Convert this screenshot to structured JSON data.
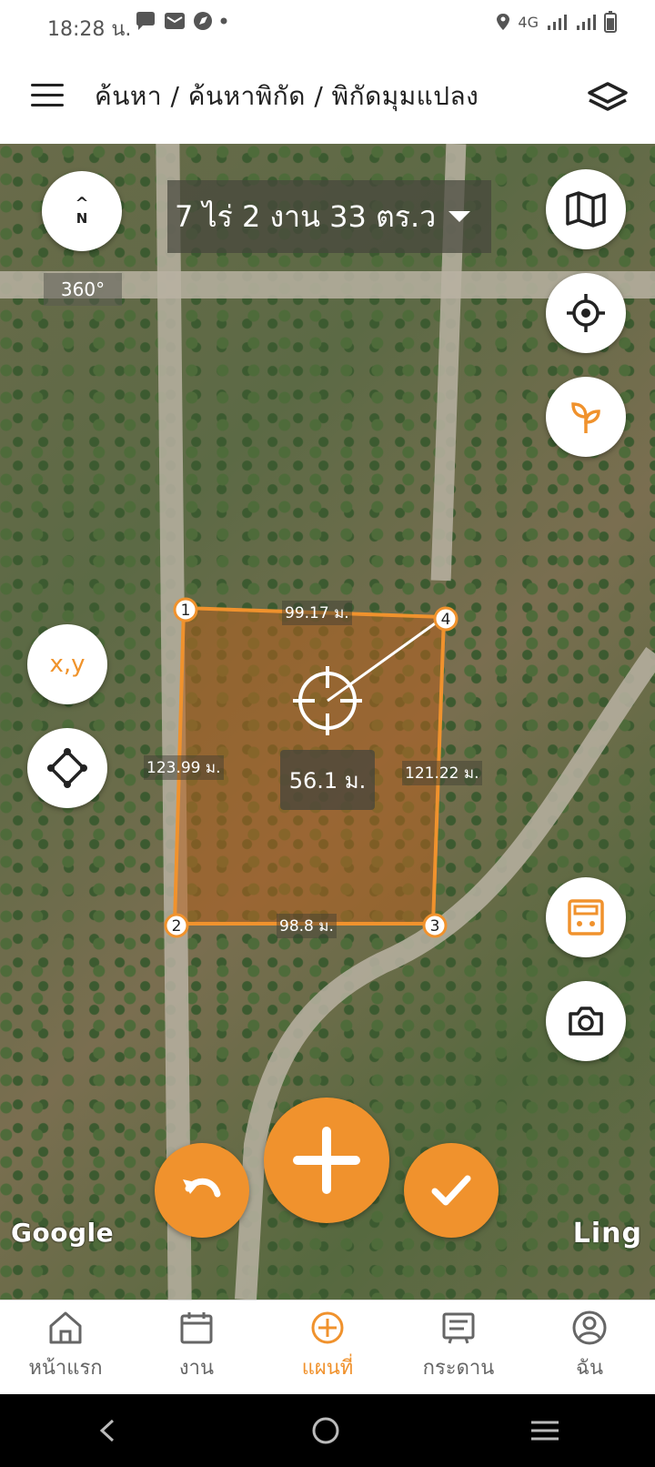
{
  "status": {
    "time": "18:28 น.",
    "network": "4G"
  },
  "appbar": {
    "title": "ค้นหา / ค้นหาพิกัด / พิกัดมุมแปลง"
  },
  "map": {
    "compass_north": "N",
    "rotation": "360°",
    "area_text": "7 ไร่ 2 งาน 33 ตร.ว",
    "xy_label": "x,y",
    "distance_label": "56.1 ม.",
    "edges": {
      "top": "99.17 ม.",
      "left": "123.99 ม.",
      "right": "121.22 ม.",
      "bottom": "98.8 ม."
    },
    "points": [
      "1",
      "2",
      "3",
      "4"
    ],
    "attribution_google": "Google",
    "attribution_ling": "Ling"
  },
  "nav": {
    "items": [
      {
        "label": "หน้าแรก",
        "icon": "home-icon"
      },
      {
        "label": "งาน",
        "icon": "calendar-icon"
      },
      {
        "label": "แผนที่",
        "icon": "map-plus-icon"
      },
      {
        "label": "กระดาน",
        "icon": "board-icon"
      },
      {
        "label": "ฉัน",
        "icon": "profile-icon"
      }
    ],
    "active_index": 2
  },
  "colors": {
    "accent": "#f0922d",
    "parcel_fill": "#b4601e"
  }
}
